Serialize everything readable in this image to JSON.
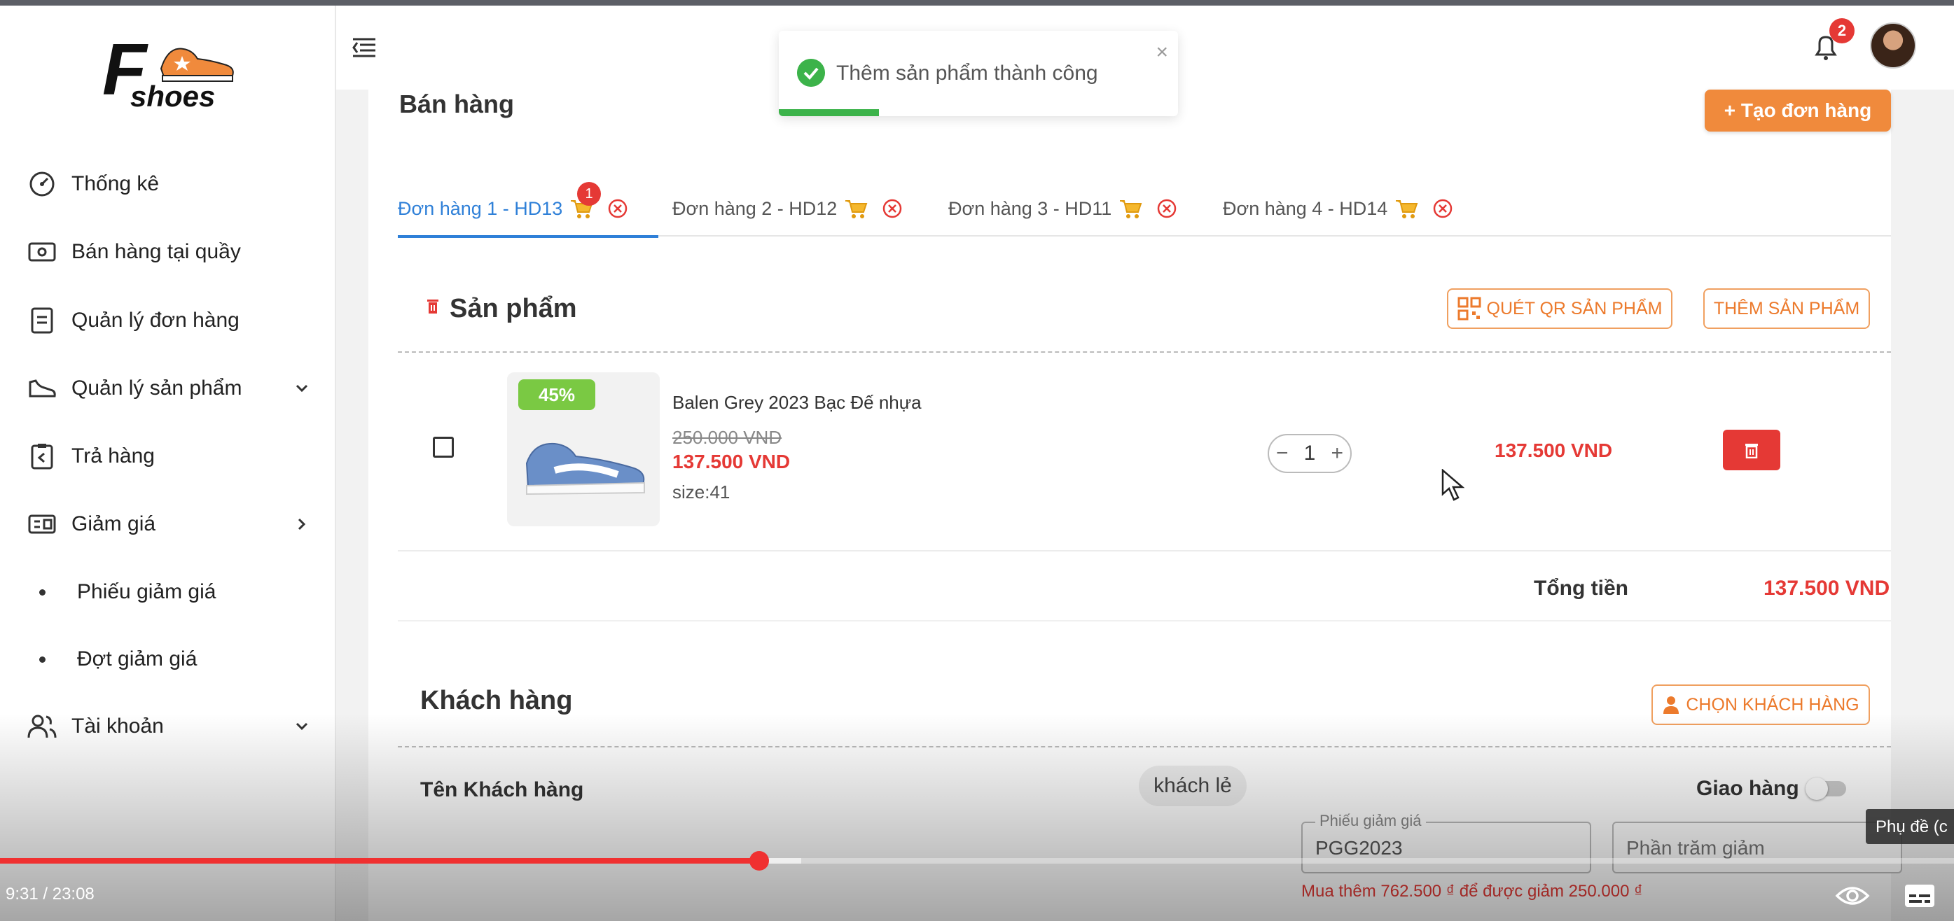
{
  "brand": {
    "logo_letter": "F",
    "logo_text": "shoes"
  },
  "sidebar": {
    "items": [
      {
        "label": "Thống kê",
        "icon": "dashboard-gauge-icon"
      },
      {
        "label": "Bán hàng tại quầy",
        "icon": "cash-icon"
      },
      {
        "label": "Quản lý đơn hàng",
        "icon": "document-icon"
      },
      {
        "label": "Quản lý sản phẩm",
        "icon": "shoe-icon",
        "expand": "chevron-down"
      },
      {
        "label": "Trả hàng",
        "icon": "return-clipboard-icon"
      },
      {
        "label": "Giảm giá",
        "icon": "coupon-icon",
        "expand": "chevron-right"
      },
      {
        "label": "Phiếu giảm giá",
        "sub": true
      },
      {
        "label": "Đợt giảm giá",
        "sub": true
      },
      {
        "label": "Tài khoản",
        "icon": "users-icon",
        "expand": "chevron-down"
      }
    ]
  },
  "header": {
    "notification_count": "2"
  },
  "toast": {
    "message": "Thêm sản phẩm thành công",
    "close": "×",
    "progress": 0.25,
    "color": "#3cb34a"
  },
  "page": {
    "title": "Bán hàng",
    "create_button": "+ Tạo đơn hàng"
  },
  "tabs": [
    {
      "label": "Đơn hàng 1 - HD13",
      "badge": "1",
      "active": true
    },
    {
      "label": "Đơn hàng 2 - HD12"
    },
    {
      "label": "Đơn hàng 3 - HD11"
    },
    {
      "label": "Đơn hàng 4 - HD14"
    }
  ],
  "products_section": {
    "title": "Sản phẩm",
    "scan_button": "QUÉT QR SẢN PHẨM",
    "add_button": "THÊM SẢN PHẨM",
    "items": [
      {
        "discount": "45%",
        "name": "Balen Grey 2023 Bạc Đế nhựa",
        "old_price": "250.000 VND",
        "new_price": "137.500 VND",
        "size": "size:41",
        "quantity": "1",
        "line_total": "137.500 VND"
      }
    ],
    "stepper_minus": "−",
    "stepper_plus": "+",
    "total_label": "Tổng tiền",
    "total_value": "137.500 VND"
  },
  "customer_section": {
    "title": "Khách hàng",
    "choose_button": "CHỌN KHÁCH HÀNG",
    "name_label": "Tên Khách hàng",
    "name_value": "khách lẻ",
    "shipping_label": "Giao hàng",
    "voucher_legend": "Phiếu giảm giá",
    "voucher_value": "PGG2023",
    "percent_placeholder": "Phần trăm giảm",
    "promo_note": "Mua thêm 762.500 ₫ để được giảm 250.000 ₫"
  },
  "video": {
    "time": "9:31 / 23:08",
    "played": 0.3886,
    "buffered": 0.41,
    "cc_tooltip": "Phụ đề (c"
  },
  "colors": {
    "accent": "#f08a3c",
    "primary": "#2f80d8",
    "danger": "#e53935",
    "success": "#3cb34a"
  }
}
